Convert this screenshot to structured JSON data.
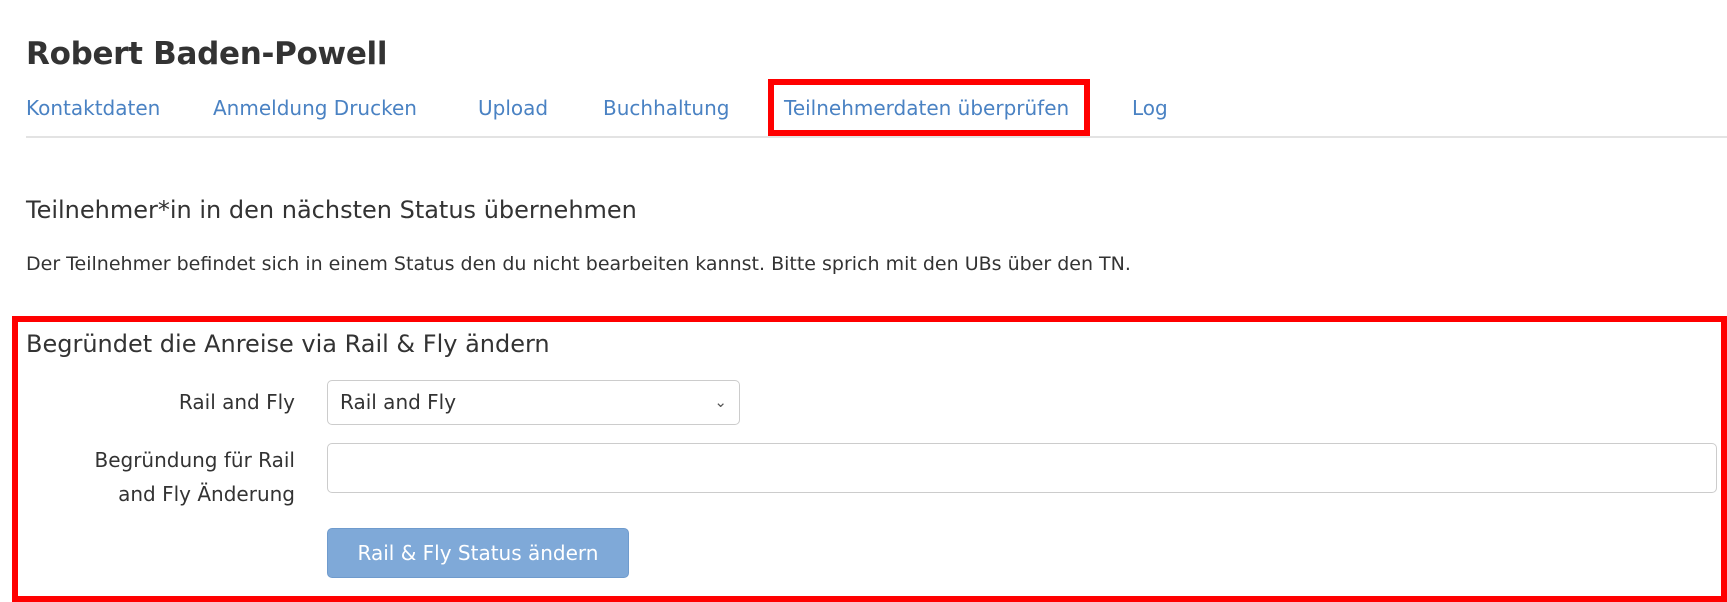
{
  "header": {
    "title": "Robert Baden-Powell"
  },
  "tabs": [
    {
      "label": "Kontaktdaten"
    },
    {
      "label": "Anmeldung Drucken"
    },
    {
      "label": "Upload"
    },
    {
      "label": "Buchhaltung"
    },
    {
      "label": "Teilnehmerdaten überprüfen"
    },
    {
      "label": "Log"
    }
  ],
  "status": {
    "heading": "Teilnehmer*in in den nächsten Status übernehmen",
    "message": "Der Teilnehmer befindet sich in einem Status den du nicht bearbeiten kannst. Bitte sprich mit den UBs über den TN."
  },
  "rail_fly": {
    "heading": "Begründet die Anreise via Rail & Fly ändern",
    "select_label": "Rail and Fly",
    "select_value": "Rail and Fly",
    "reason_label_line1": "Begründung für Rail",
    "reason_label_line2": "and Fly Änderung",
    "reason_value": "",
    "submit_label": "Rail & Fly Status ändern"
  },
  "colors": {
    "link": "#4a82c3",
    "highlight": "#ff0000",
    "button": "#7fa9d8"
  }
}
